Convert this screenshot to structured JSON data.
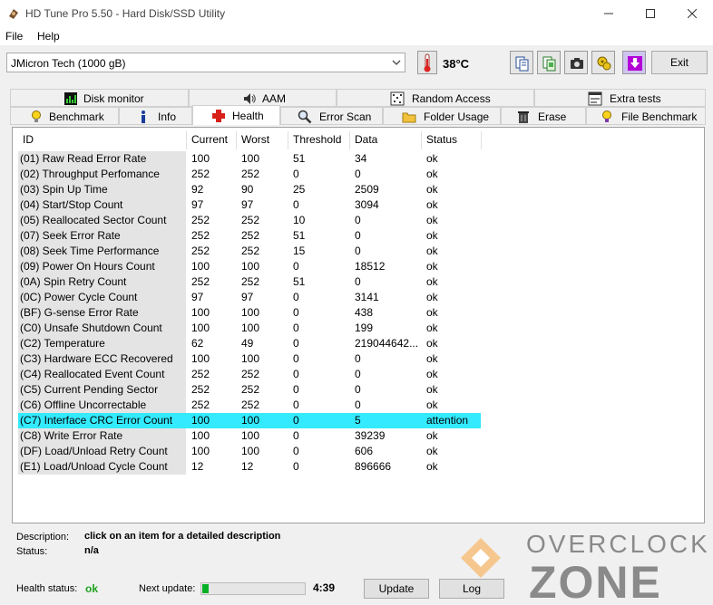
{
  "window": {
    "title": "HD Tune Pro 5.50 - Hard Disk/SSD Utility"
  },
  "menu": {
    "file": "File",
    "help": "Help"
  },
  "toolbar": {
    "drive": "JMicron Tech (1000 gB)",
    "temperature": "38°C",
    "exit_label": "Exit",
    "icons": [
      "copy-text-icon",
      "copy-screenshot-icon",
      "camera-icon",
      "options-icon",
      "save-icon"
    ]
  },
  "tabs_top": [
    "Disk monitor",
    "AAM",
    "Random Access",
    "Extra tests"
  ],
  "tabs_bottom": [
    "Benchmark",
    "Info",
    "Health",
    "Error Scan",
    "Folder Usage",
    "Erase",
    "File Benchmark"
  ],
  "active_tab": "Health",
  "table": {
    "headers": [
      "ID",
      "Current",
      "Worst",
      "Threshold",
      "Data",
      "Status"
    ],
    "rows": [
      [
        "(01) Raw Read Error Rate",
        "100",
        "100",
        "51",
        "34",
        "ok"
      ],
      [
        "(02) Throughput Perfomance",
        "252",
        "252",
        "0",
        "0",
        "ok"
      ],
      [
        "(03) Spin Up Time",
        "92",
        "90",
        "25",
        "2509",
        "ok"
      ],
      [
        "(04) Start/Stop Count",
        "97",
        "97",
        "0",
        "3094",
        "ok"
      ],
      [
        "(05) Reallocated Sector Count",
        "252",
        "252",
        "10",
        "0",
        "ok"
      ],
      [
        "(07) Seek Error Rate",
        "252",
        "252",
        "51",
        "0",
        "ok"
      ],
      [
        "(08) Seek Time Performance",
        "252",
        "252",
        "15",
        "0",
        "ok"
      ],
      [
        "(09) Power On Hours Count",
        "100",
        "100",
        "0",
        "18512",
        "ok"
      ],
      [
        "(0A) Spin Retry Count",
        "252",
        "252",
        "51",
        "0",
        "ok"
      ],
      [
        "(0C) Power Cycle Count",
        "97",
        "97",
        "0",
        "3141",
        "ok"
      ],
      [
        "(BF) G-sense Error Rate",
        "100",
        "100",
        "0",
        "438",
        "ok"
      ],
      [
        "(C0) Unsafe Shutdown Count",
        "100",
        "100",
        "0",
        "199",
        "ok"
      ],
      [
        "(C2) Temperature",
        "62",
        "49",
        "0",
        "219044642...",
        "ok"
      ],
      [
        "(C3) Hardware ECC Recovered",
        "100",
        "100",
        "0",
        "0",
        "ok"
      ],
      [
        "(C4) Reallocated Event Count",
        "252",
        "252",
        "0",
        "0",
        "ok"
      ],
      [
        "(C5) Current Pending Sector",
        "252",
        "252",
        "0",
        "0",
        "ok"
      ],
      [
        "(C6) Offline Uncorrectable",
        "252",
        "252",
        "0",
        "0",
        "ok"
      ],
      [
        "(C7) Interface CRC Error Count",
        "100",
        "100",
        "0",
        "5",
        "attention"
      ],
      [
        "(C8) Write Error Rate",
        "100",
        "100",
        "0",
        "39239",
        "ok"
      ],
      [
        "(DF) Load/Unload Retry Count",
        "100",
        "100",
        "0",
        "606",
        "ok"
      ],
      [
        "(E1) Load/Unload Cycle Count",
        "12",
        "12",
        "0",
        "896666",
        "ok"
      ]
    ],
    "highlight_row": 17,
    "highlight_color": "#33eaff"
  },
  "details": {
    "description_label": "Description:",
    "description_value": "click on an item for a detailed description",
    "status_label": "Status:",
    "status_value": "n/a"
  },
  "footer": {
    "health_label": "Health status:",
    "health_value": "ok",
    "health_color": "#1fa31f",
    "next_update_label": "Next update:",
    "progress_fraction": 0.06,
    "time": "4:39",
    "update_label": "Update",
    "log_label": "Log"
  },
  "watermark": {
    "line1": "OVERCLOCK",
    "line2": "ZONE"
  }
}
